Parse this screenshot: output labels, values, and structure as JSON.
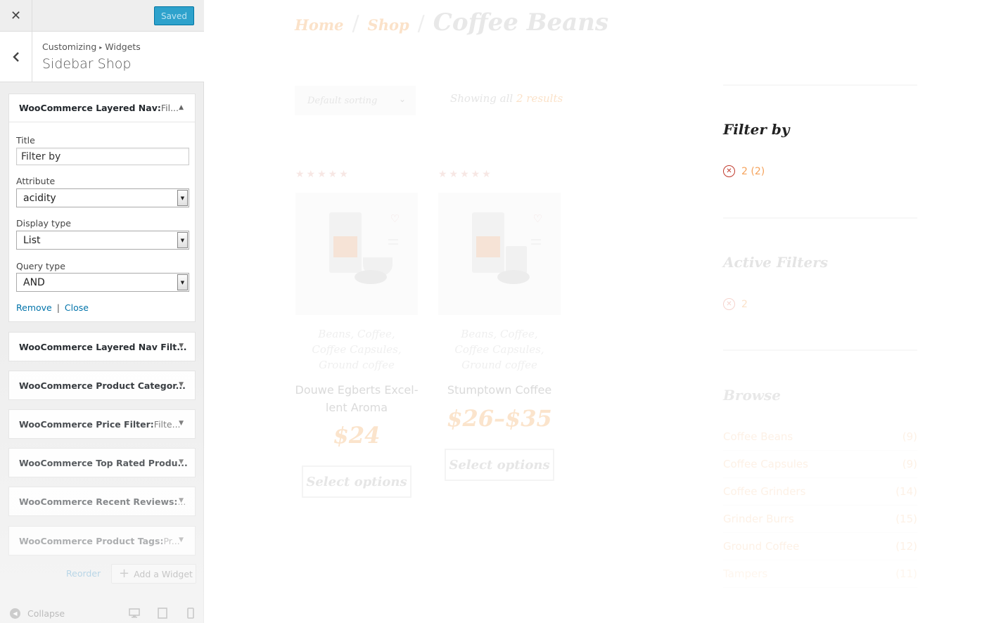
{
  "customizer": {
    "close_label": "✕",
    "saved_label": "Saved",
    "breadcrumb": {
      "root": "Customizing",
      "separator": "▸",
      "current": "Widgets"
    },
    "section_title": "Sidebar Shop",
    "widgets": [
      {
        "title": "WooCommerce Layered Nav:",
        "subtitle": " Fil...",
        "expanded": true,
        "fields": {
          "title_label": "Title",
          "title_value": "Filter by",
          "attribute_label": "Attribute",
          "attribute_value": "acidity",
          "display_type_label": "Display type",
          "display_type_value": "List",
          "query_type_label": "Query type",
          "query_type_value": "AND"
        },
        "remove_label": "Remove",
        "separator": "|",
        "close_label": "Close"
      },
      {
        "title": "WooCommerce Layered Nav Filt...",
        "subtitle": ""
      },
      {
        "title": "WooCommerce Product Categor...",
        "subtitle": ""
      },
      {
        "title": "WooCommerce Price Filter:",
        "subtitle": " Filte..."
      },
      {
        "title": "WooCommerce Top Rated Produ...",
        "subtitle": ""
      },
      {
        "title": "WooCommerce Recent Reviews:",
        "subtitle": " ..."
      },
      {
        "title": "WooCommerce Product Tags:",
        "subtitle": " Pr..."
      }
    ],
    "reorder_label": "Reorder",
    "add_widget_label": "Add a Widget",
    "collapse_label": "Collapse",
    "icons": {
      "back": "chevron-left-icon",
      "add": "plus-icon",
      "collapse": "collapse-arrow-icon",
      "desktop": "desktop-icon",
      "tablet": "tablet-icon",
      "mobile": "mobile-icon"
    }
  },
  "preview": {
    "breadcrumb": {
      "home": "Home",
      "shop": "Shop",
      "current": "Coffee Beans",
      "separator": "/"
    },
    "sorting": {
      "selected": "Default sorting"
    },
    "result_count": {
      "prefix": "Showing all",
      "count": "2 results"
    },
    "products": [
      {
        "rating": "★★★★★",
        "categories": [
          "Beans, Coffee,",
          "Coffee Capsules,",
          "Ground coffee"
        ],
        "name_lines": [
          "Douwe Egberts Excel-",
          "lent Aroma"
        ],
        "price": "$24",
        "button": "Select options"
      },
      {
        "rating": "★★★★★",
        "categories": [
          "Beans, Coffee,",
          "Coffee Capsules,",
          "Ground coffee"
        ],
        "name_lines": [
          "Stumptown Coffee"
        ],
        "price": "$26–$35",
        "button": "Select options"
      }
    ],
    "sidebar": {
      "filter_by": {
        "title": "Filter by",
        "item": "2 (2)"
      },
      "active_filters": {
        "title": "Active Filters",
        "item": "2"
      },
      "browse": {
        "title": "Browse",
        "categories": [
          {
            "name": "Coffee Beans",
            "count": "(9)"
          },
          {
            "name": "Coffee Capsules",
            "count": "(9)"
          },
          {
            "name": "Coffee Grinders",
            "count": "(14)"
          },
          {
            "name": "Grinder Burrs",
            "count": "(15)"
          },
          {
            "name": "Ground Coffee",
            "count": "(12)"
          },
          {
            "name": "Tampers",
            "count": "(11)"
          }
        ]
      }
    },
    "colors": {
      "accent": "#f5a35c",
      "filter_red": "#c0392b",
      "text_dark": "#222222"
    }
  }
}
